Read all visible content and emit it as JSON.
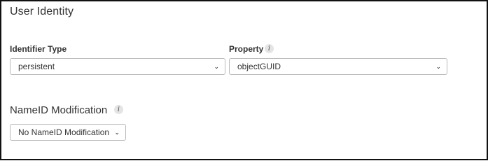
{
  "section": {
    "title": "User Identity"
  },
  "identifier_type": {
    "label": "Identifier Type",
    "selected": "persistent"
  },
  "property": {
    "label": "Property",
    "selected": "objectGUID"
  },
  "nameid": {
    "title": "NameID Modification",
    "selected": "No NameID Modification"
  },
  "icons": {
    "info": "info-icon",
    "dropdown": "chevron-down-icon"
  },
  "glyphs": {
    "info": "i",
    "chevron": "⌄"
  }
}
